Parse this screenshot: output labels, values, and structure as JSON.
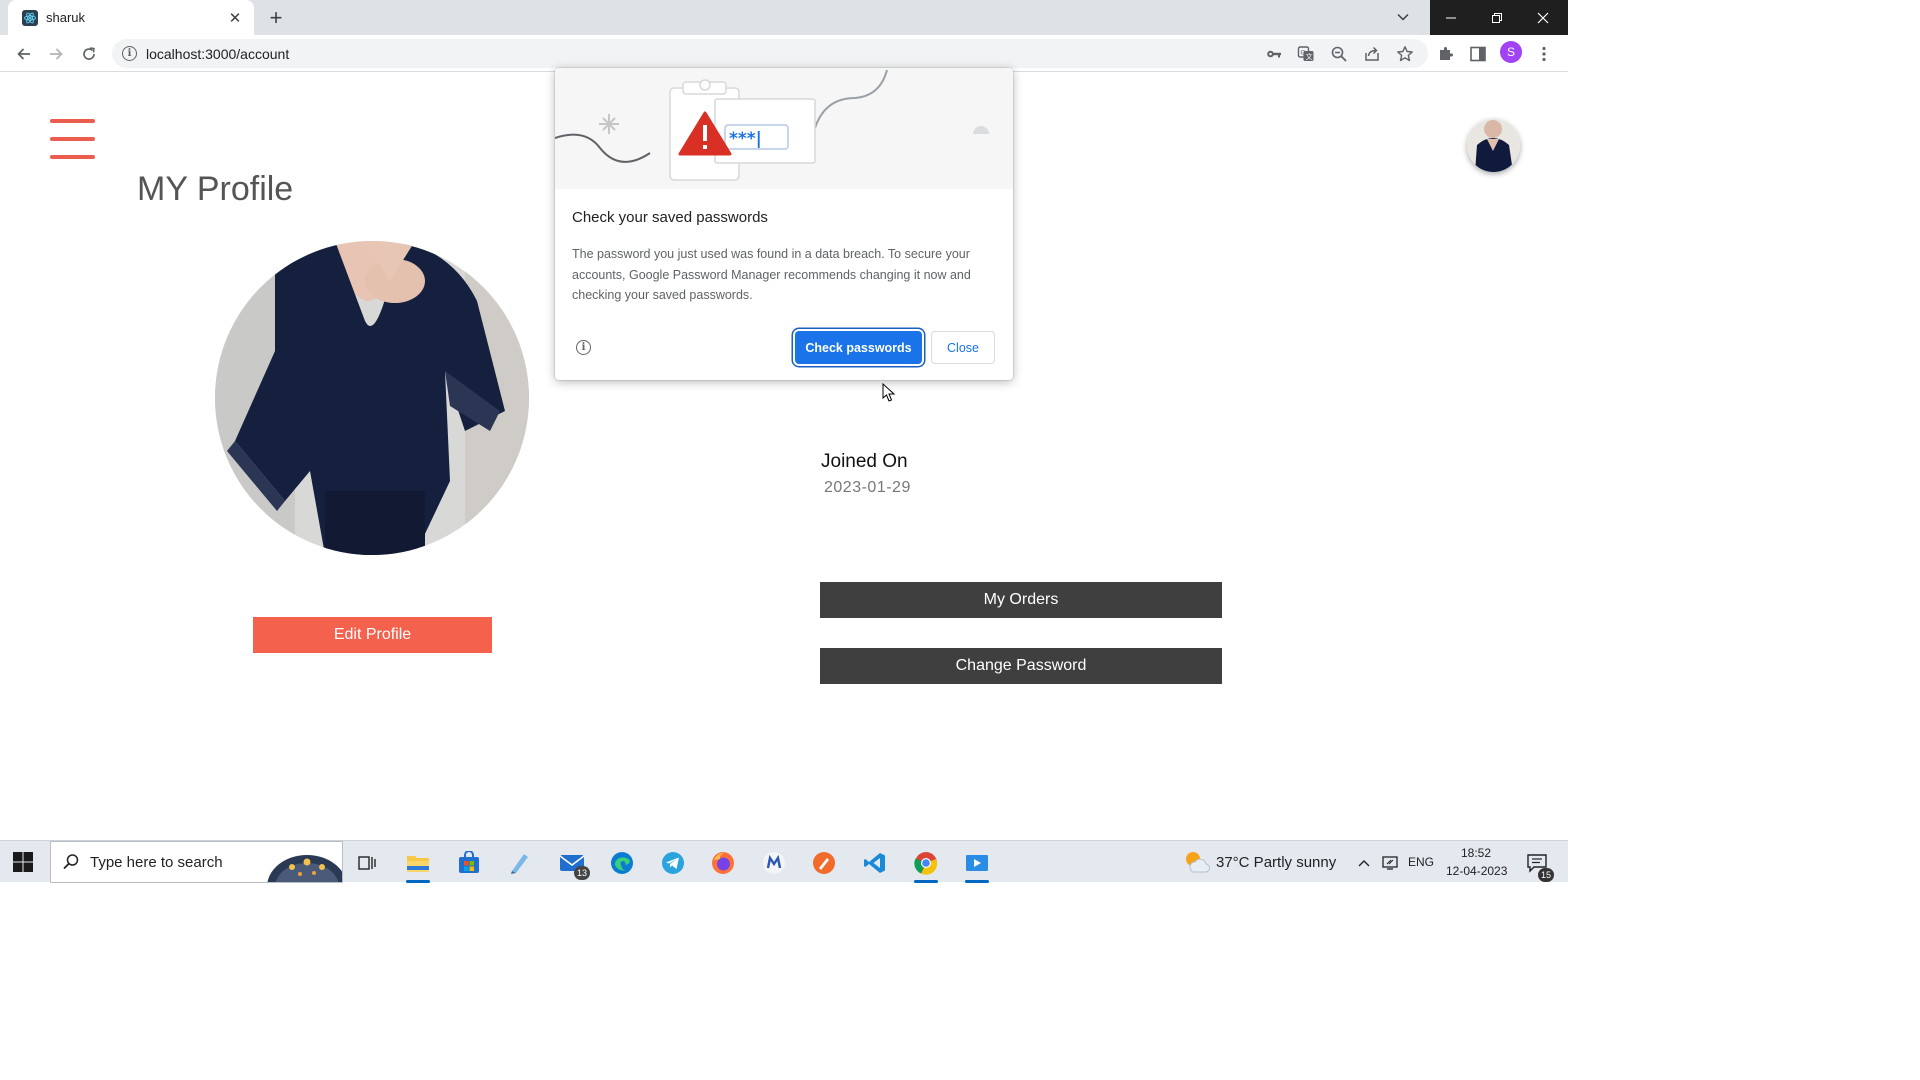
{
  "browser": {
    "tab_title": "sharuk",
    "url": "localhost:3000/account",
    "profile_initial": "S"
  },
  "page": {
    "title": "MY Profile",
    "joined_label": "Joined On",
    "joined_value": "2023-01-29",
    "edit_profile_label": "Edit Profile",
    "my_orders_label": "My Orders",
    "change_password_label": "Change Password"
  },
  "popup": {
    "title": "Check your saved passwords",
    "body": "The password you just used was found in a data breach. To secure your accounts, Google Password Manager recommends changing it now and checking your saved passwords.",
    "illustration_text": "***|",
    "check_label": "Check passwords",
    "close_label": "Close"
  },
  "taskbar": {
    "search_placeholder": "Type here to search",
    "mail_badge": "13",
    "weather": "37°C  Partly sunny",
    "language": "ENG",
    "time": "18:52",
    "date": "12-04-2023",
    "notification_count": "15"
  },
  "colors": {
    "accent_red": "#f4624e",
    "hamburger": "#ea5d4f",
    "dark_button": "#3f3f3f",
    "chrome_blue": "#1a73e8"
  }
}
